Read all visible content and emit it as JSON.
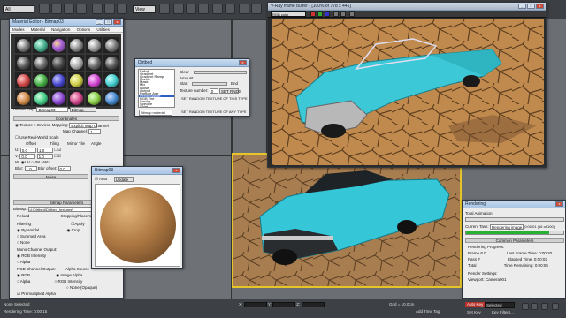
{
  "topbar": {
    "left_dropdown": "All",
    "view_dropdown": "View"
  },
  "material_editor": {
    "title": "Material Editor - Bitmap03",
    "menu": [
      "Modes",
      "Material",
      "Navigation",
      "Options",
      "Utilities"
    ],
    "map_label": "Diffuse map:",
    "map_name": "Bitmap03",
    "map_type": "Bitmap",
    "sections": {
      "coordinates": "Coordinates",
      "noise": "Noise",
      "bitmap_params": "Bitmap Parameters",
      "time": "Time",
      "output": "Output"
    },
    "texture_radio": "Texture",
    "environ_radio": "Environ",
    "mapping_label": "Mapping:",
    "mapping_value": "Explicit Map Channel",
    "map_channel_label": "Map Channel:",
    "map_channel_value": "1",
    "real_world_label": "Use Real-World Scale",
    "offset_label": "Offset",
    "tiling_label": "Tiling",
    "mirror_tile_label": "Mirror Tile",
    "angle_label": "Angle",
    "u_label": "U:",
    "v_label": "V:",
    "w_label": "W:",
    "u_offset": "0.0",
    "v_offset": "0.0",
    "u_tiling": "1.0",
    "v_tiling": "1.0",
    "uv_label": "UV",
    "vw_label": "VW",
    "wu_label": "WU",
    "blur_label": "Blur:",
    "blur_value": "1.0",
    "blur_offset_label": "Blur offset:",
    "blur_offset_value": "0.0",
    "bitmap_path_label": "Bitmap:",
    "bitmap_path": "d:\\Dirtbed\\Dirtbed_textures\\",
    "reload_label": "Reload",
    "cropping_label": "Cropping/Placement",
    "filtering_label": "Filtering",
    "pyramidal_label": "Pyramidal",
    "summed_area_label": "Summed Area",
    "none_label": "None",
    "apply_label": "Apply",
    "crop_label": "Crop",
    "mono_output_label": "Mono Channel Output:",
    "rgb_intensity_label": "RGB Intensity",
    "alpha_label": "Alpha",
    "rgb_output_label": "RGB Channel Output:",
    "rgb_label": "RGB",
    "alpha_source_label": "Alpha Source",
    "image_alpha_label": "Image Alpha",
    "rgb_intensity2_label": "RGB Intensity",
    "none_opaque_label": "None (Opaque)",
    "premultiplied_label": "Premultiplied Alpha"
  },
  "texmap_dialog": {
    "title": "Dirtbed",
    "list": [
      "Falloff",
      "Gradient",
      "Gradient Ramp",
      "Marble",
      "Mask",
      "Mix",
      "Noise",
      "Output",
      "Particle Age",
      "Perlin Marble",
      "RGB Tint",
      "Smoke",
      "Speckle",
      "Splat"
    ],
    "selected_index": 9,
    "clear_label": "Clear",
    "amount_label": "Amount",
    "start_label": "Start",
    "end_label": "End",
    "texture_number_label": "Texture number:",
    "texture_number": "0",
    "set_button": "SET RNDS",
    "set_random_button": "SET RANDOM TEXTURE OF THIS TYPE",
    "set_any_button": "SET RANDOM TEXTURE OF ANY TYPE",
    "dropdown": "Bitmap material"
  },
  "render_frame": {
    "title": "V-Ray frame buffer - [100% of 778 x 441]",
    "channel_dropdown": "RGB color"
  },
  "bitmap_preview": {
    "title": "Bitmap03",
    "auto_label": "Auto",
    "update_label": "Update"
  },
  "rendering": {
    "title": "Rendering",
    "total_animation": "Total Animation:",
    "current_task_label": "Current Task:",
    "current_task": "Rendering image...",
    "task_time": "0:00:01 (16 of 100)",
    "common_params": "Common Parameters",
    "rendering_progress": "Rendering Progress:",
    "frame_label": "Frame #",
    "frame_value": "0",
    "last_frame_label": "Last Frame Time:",
    "last_frame_value": "0:00:20",
    "pass_label": "Pass #",
    "elapsed_label": "Elapsed Time:",
    "elapsed_value": "0:00:02",
    "total_label": "Total",
    "time_remaining_label": "Time Remaining:",
    "time_remaining_value": "0:00:05",
    "render_settings": "Render Settings:",
    "viewport_label": "Viewport:",
    "viewport_value": "Camera001",
    "progress_pct": 0.85
  },
  "statusbar": {
    "selection": "None Selected",
    "prompt": "Rendering Time: 0:00:15",
    "x_label": "X:",
    "y_label": "Y:",
    "z_label": "Z:",
    "grid_label": "Grid = 10.0cm",
    "add_time_tag": "Add Time Tag",
    "auto_key": "Auto Key",
    "selected_label": "Selected",
    "set_key": "Set Key",
    "key_filters": "Key Filters..."
  },
  "colors": {
    "car_cyan": "#3cc8d6",
    "ground": "#c08a4e",
    "selected_list": "#2a5fbf"
  }
}
